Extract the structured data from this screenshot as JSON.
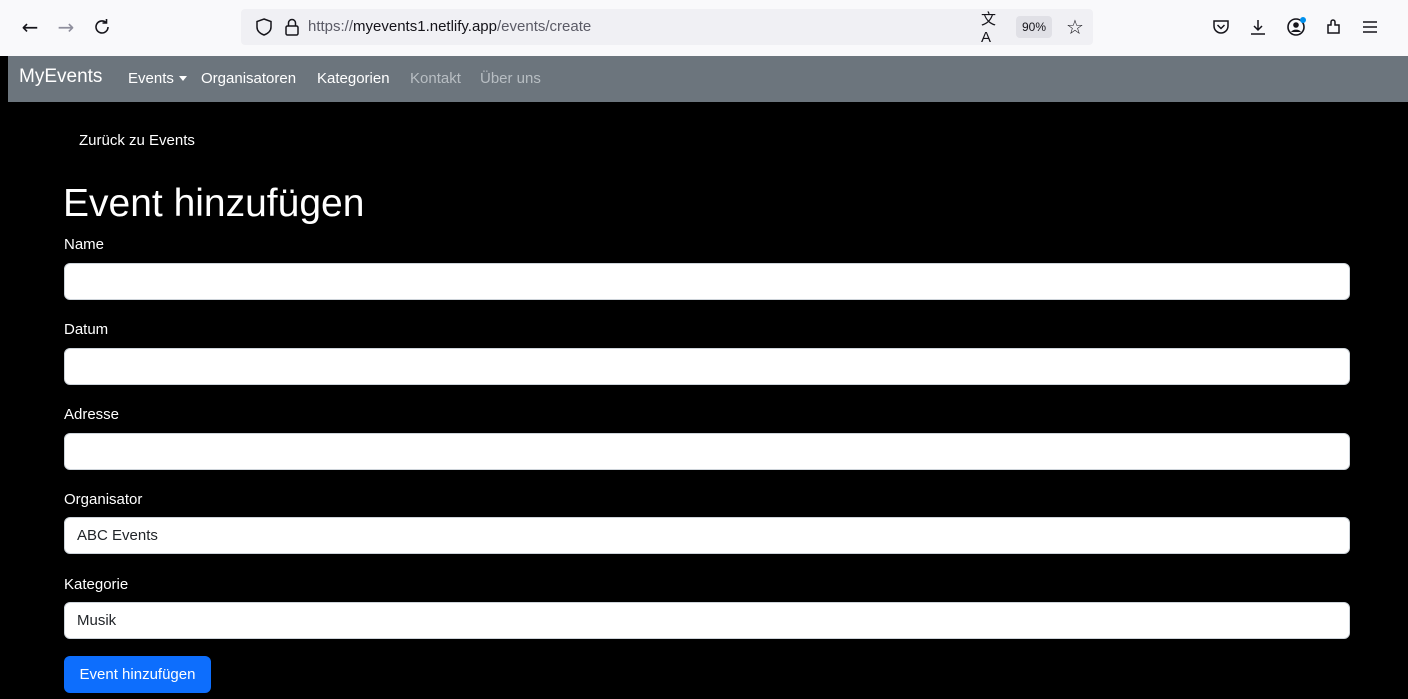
{
  "browser": {
    "url_prefix": "https://",
    "url_host": "myevents1.netlify.app",
    "url_path": "/events/create",
    "zoom": "90%",
    "icons": [
      "back-arrow-icon",
      "forward-arrow-icon",
      "reload-icon",
      "shield-icon",
      "lock-icon",
      "translate-icon",
      "star-icon",
      "pocket-icon",
      "download-icon",
      "account-icon",
      "extensions-icon",
      "menu-icon"
    ]
  },
  "navbar": {
    "brand": "MyEvents",
    "items": [
      {
        "label": "Events",
        "dropdown": true,
        "state": "active"
      },
      {
        "label": "Organisatoren",
        "state": "active"
      },
      {
        "label": "Kategorien",
        "state": "active"
      },
      {
        "label": "Kontakt",
        "state": "muted"
      },
      {
        "label": "Über uns",
        "state": "muted"
      }
    ],
    "colors": {
      "background": "#6c757d",
      "active": "#ffffff",
      "muted": "#b8bec3"
    }
  },
  "main": {
    "back_link": "Zurück zu Events",
    "title": "Event hinzufügen",
    "fields": [
      {
        "label": "Name",
        "value": ""
      },
      {
        "label": "Datum",
        "value": ""
      },
      {
        "label": "Adresse",
        "value": ""
      },
      {
        "label": "Organisator",
        "value": "ABC Events"
      },
      {
        "label": "Kategorie",
        "value": "Musik"
      }
    ],
    "submit_label": "Event hinzufügen",
    "colors": {
      "background": "#000000",
      "button": "#0d6efd"
    }
  }
}
